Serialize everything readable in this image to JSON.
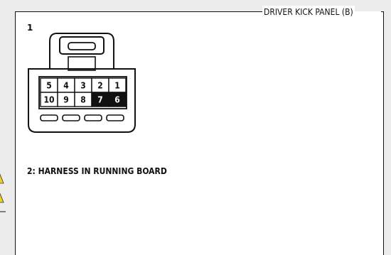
{
  "panel": {
    "title": "DRIVER KICK PANEL (B)"
  },
  "connector": {
    "number": "1",
    "pins": [
      {
        "label": "5",
        "row": 0,
        "col": 0,
        "filled": false
      },
      {
        "label": "4",
        "row": 0,
        "col": 1,
        "filled": false
      },
      {
        "label": "3",
        "row": 0,
        "col": 2,
        "filled": false
      },
      {
        "label": "2",
        "row": 0,
        "col": 3,
        "filled": false
      },
      {
        "label": "1",
        "row": 0,
        "col": 4,
        "filled": false
      },
      {
        "label": "10",
        "row": 1,
        "col": 0,
        "filled": false
      },
      {
        "label": "9",
        "row": 1,
        "col": 1,
        "filled": false
      },
      {
        "label": "8",
        "row": 1,
        "col": 2,
        "filled": false
      },
      {
        "label": "7",
        "row": 1,
        "col": 3,
        "filled": true
      },
      {
        "label": "6",
        "row": 1,
        "col": 4,
        "filled": true
      }
    ],
    "colors": {
      "outline": "#111111",
      "filled_pin": "#111111",
      "empty_pin": "#ffffff"
    }
  },
  "harness": {
    "label": "2: HARNESS IN RUNNING BOARD"
  },
  "warning_icons": [
    "warning-triangle-icon",
    "warning-triangle-icon"
  ]
}
